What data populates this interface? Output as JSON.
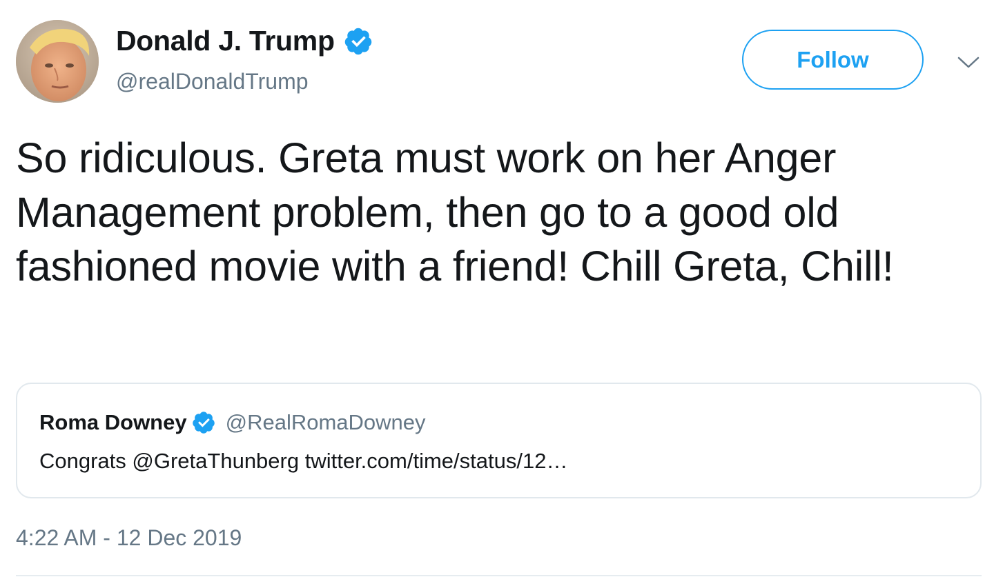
{
  "author": {
    "display_name": "Donald J. Trump",
    "handle": "@realDonaldTrump",
    "verified_icon": "verified-badge-icon",
    "avatar": "avatar-photo"
  },
  "actions": {
    "follow_label": "Follow",
    "menu_icon": "chevron-down-icon"
  },
  "tweet": {
    "text": "So ridiculous. Greta must work on her Anger Management problem, then go to a good old fashioned movie with a friend! Chill Greta, Chill!",
    "timestamp": "4:22 AM - 12 Dec 2019"
  },
  "quoted_tweet": {
    "display_name": "Roma Downey",
    "handle": "@RealRomaDowney",
    "text": "Congrats @GretaThunberg twitter.com/time/status/12…",
    "verified_icon": "verified-badge-icon"
  },
  "colors": {
    "accent": "#1da1f2",
    "text_primary": "#14171a",
    "text_secondary": "#657786",
    "border": "#e1e8ed"
  }
}
